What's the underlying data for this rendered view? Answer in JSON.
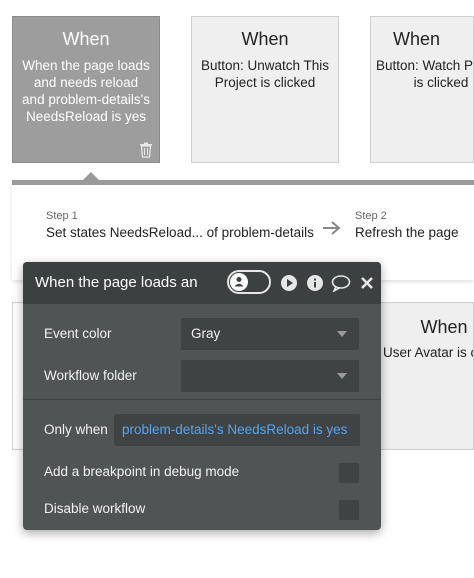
{
  "cards": [
    {
      "title": "When",
      "desc": "When the page loads and needs reload and problem-details's NeedsReload is yes"
    },
    {
      "title": "When",
      "desc": "Button: Unwatch This Project is clicked"
    },
    {
      "title": "When",
      "desc": "Button: Watch Project is clicked"
    }
  ],
  "steps": [
    {
      "label": "Step 1",
      "text": "Set states NeedsReload... of problem-details"
    },
    {
      "label": "Step 2",
      "text": "Refresh the page"
    }
  ],
  "card_lower": {
    "title": "When",
    "desc": "User Avatar is cl"
  },
  "panel": {
    "title": "When the page loads an",
    "event_color_label": "Event color",
    "event_color_value": "Gray",
    "workflow_folder_label": "Workflow folder",
    "workflow_folder_value": "",
    "only_when_label": "Only when",
    "only_when_value": "problem-details's NeedsReload is yes",
    "breakpoint_label": "Add a breakpoint in debug mode",
    "disable_label": "Disable workflow",
    "breakpoint_checked": false,
    "disable_checked": false
  },
  "colors": {
    "selected_card": "#9d9d9d",
    "panel_bg": "#505455",
    "panel_header": "#3c4041",
    "condition_text": "#59a4ea"
  },
  "icons": [
    "trash-icon",
    "arrow-right-icon",
    "user-toggle-icon",
    "play-icon",
    "info-icon",
    "comment-icon",
    "close-icon"
  ]
}
